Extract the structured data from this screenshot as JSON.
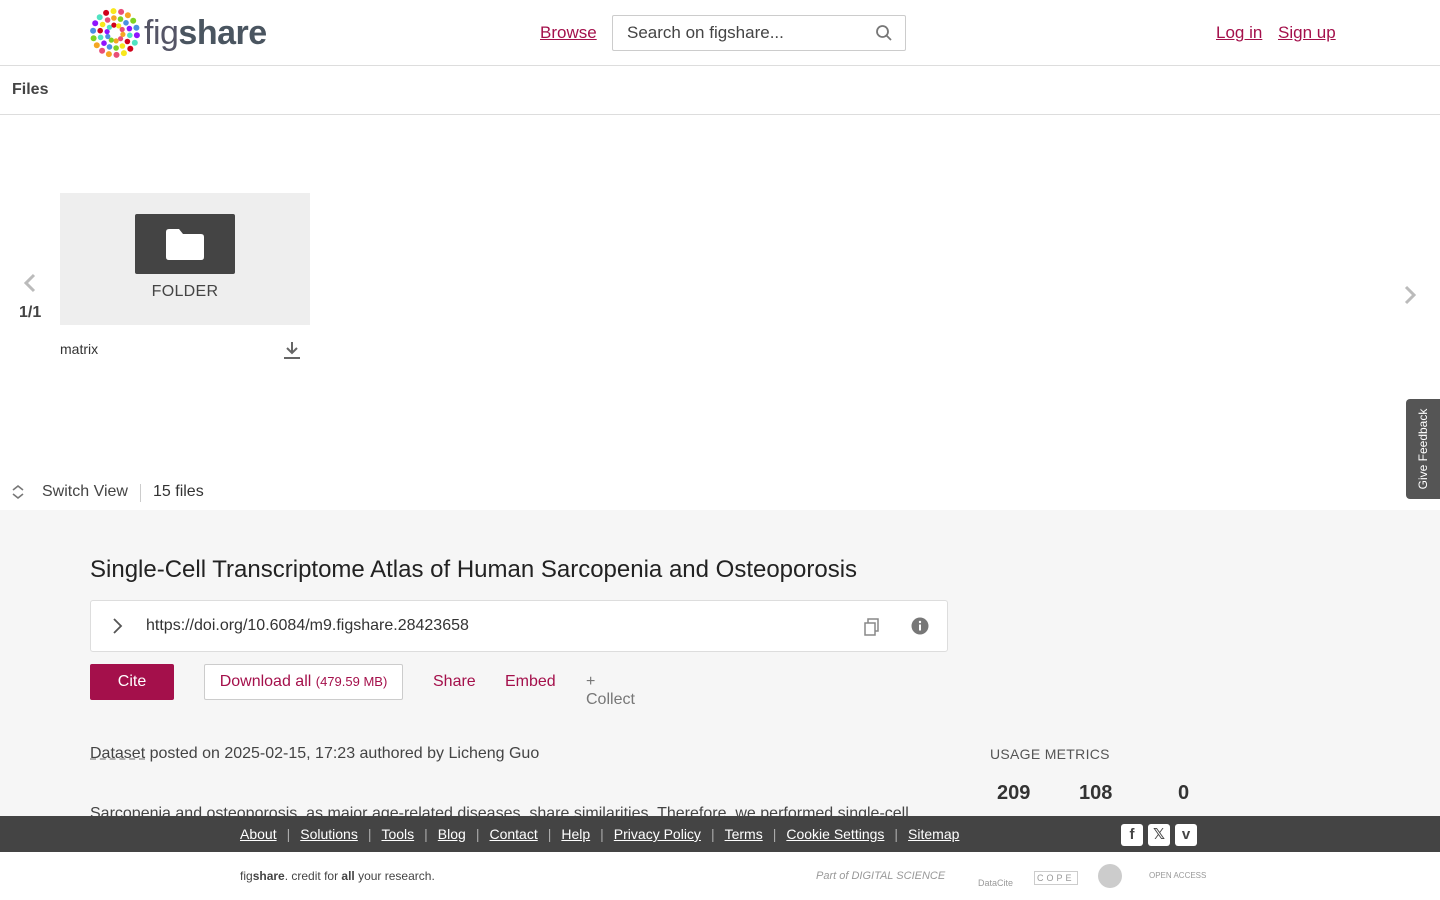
{
  "header": {
    "logo_text_light": "fig",
    "logo_text_bold": "share",
    "browse_label": "Browse",
    "search_placeholder": "Search on figshare...",
    "login_label": "Log in",
    "signup_label": "Sign up"
  },
  "files": {
    "section_title": "Files",
    "page_indicator": "1/1",
    "items": [
      {
        "type_label": "FOLDER",
        "name": "matrix"
      }
    ],
    "switch_view_label": "Switch View",
    "count_label": "15 files"
  },
  "feedback_label": "Give Feedback",
  "item": {
    "title": "Single-Cell Transcriptome Atlas of Human Sarcopenia and Osteoporosis",
    "doi": "https://doi.org/10.6084/m9.figshare.28423658",
    "cite_label": "Cite",
    "download_label": "Download all",
    "download_size": "(479.59 MB)",
    "share_label": "Share",
    "embed_label": "Embed",
    "collect_label": "+ Collect",
    "type": "Dataset",
    "posted_text": " posted on 2025-02-15, 17:23 authored by Licheng Guo",
    "abstract_start": "Sarcopenia and osteoporosis, as major age-related diseases, share similarities. Therefore, we performed single-cell"
  },
  "metrics": {
    "label": "USAGE METRICS",
    "values": [
      "209",
      "108",
      "0"
    ]
  },
  "footer": {
    "links": [
      "About",
      "Solutions",
      "Tools",
      "Blog",
      "Contact",
      "Help",
      "Privacy Policy",
      "Terms",
      "Cookie Settings",
      "Sitemap"
    ],
    "tagline_pre": "fig",
    "tagline_bold": "share",
    "tagline_mid": ". credit for ",
    "tagline_all": "all",
    "tagline_end": " your research.",
    "partners": [
      "Part of DIGITAL SCIENCE",
      "DataCite",
      "COPE",
      "OPEN ACCESS"
    ]
  },
  "colors": {
    "brand": "#a4104b",
    "footer_bg": "#444444",
    "content_bg": "#f6f6f6"
  }
}
